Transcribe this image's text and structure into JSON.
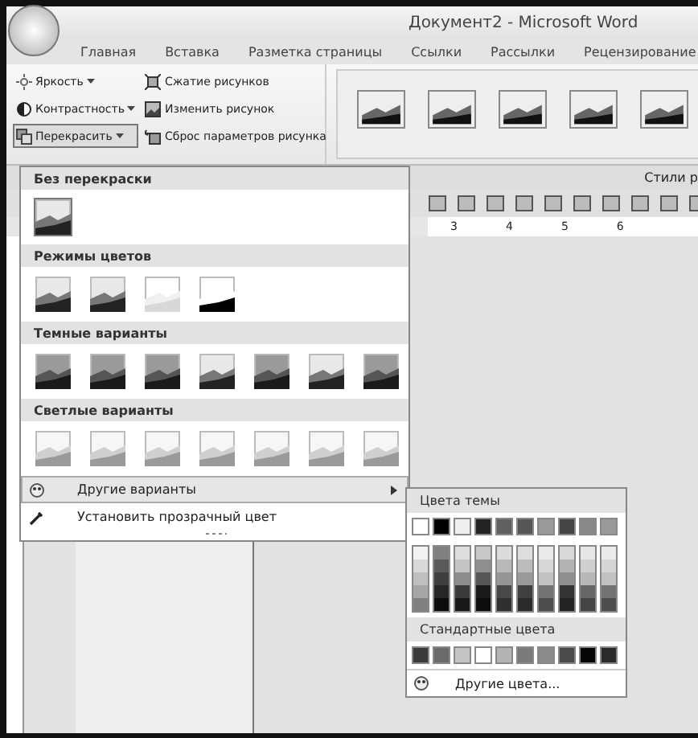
{
  "window": {
    "title": "Документ2 - Microsoft Word"
  },
  "tabs": [
    {
      "label": "Главная"
    },
    {
      "label": "Вставка"
    },
    {
      "label": "Разметка страницы"
    },
    {
      "label": "Ссылки"
    },
    {
      "label": "Рассылки"
    },
    {
      "label": "Рецензирование"
    }
  ],
  "ribbon": {
    "adjust_buttons": [
      {
        "label": "Яркость",
        "kind": "sun",
        "pressed": false
      },
      {
        "label": "Контрастность",
        "kind": "contrast",
        "pressed": false
      },
      {
        "label": "Перекрасить",
        "kind": "recolor",
        "pressed": true
      }
    ],
    "picture_buttons": [
      {
        "label": "Сжатие рисунков",
        "kind": "compress"
      },
      {
        "label": "Изменить рисунок",
        "kind": "change"
      },
      {
        "label": "Сброс параметров рисунка",
        "kind": "reset"
      }
    ],
    "group_label": "Стили р"
  },
  "ruler": {
    "marks": [
      "3",
      "4",
      "5",
      "6"
    ]
  },
  "recolor_menu": {
    "sections": [
      {
        "title": "Без перекраски",
        "thumbs": [
          {
            "kind": "normal",
            "selected": true
          }
        ]
      },
      {
        "title": "Режимы цветов",
        "thumbs": [
          {
            "kind": "normal",
            "selected": false
          },
          {
            "kind": "normal",
            "selected": false
          },
          {
            "kind": "washout",
            "selected": false
          },
          {
            "kind": "blackwhite",
            "selected": false
          }
        ]
      },
      {
        "title": "Темные варианты",
        "thumbs": [
          {
            "kind": "dark",
            "selected": false
          },
          {
            "kind": "dark",
            "selected": false
          },
          {
            "kind": "dark",
            "selected": false
          },
          {
            "kind": "normal",
            "selected": false
          },
          {
            "kind": "dark",
            "selected": false
          },
          {
            "kind": "normal",
            "selected": false
          },
          {
            "kind": "dark",
            "selected": false
          }
        ]
      },
      {
        "title": "Светлые варианты",
        "thumbs": [
          {
            "kind": "light",
            "selected": false
          },
          {
            "kind": "light",
            "selected": false
          },
          {
            "kind": "light",
            "selected": false
          },
          {
            "kind": "light",
            "selected": false
          },
          {
            "kind": "light",
            "selected": false
          },
          {
            "kind": "light",
            "selected": false
          },
          {
            "kind": "light",
            "selected": false
          }
        ]
      }
    ],
    "items": [
      {
        "label": "Другие варианты",
        "kind": "submenu",
        "highlighted": true
      },
      {
        "label": "Установить прозрачный цвет",
        "kind": "eyedropper",
        "highlighted": false
      }
    ]
  },
  "color_menu": {
    "theme_title": "Цвета темы",
    "theme_colors": [
      {
        "color": "#ffffff",
        "shades": [
          {
            "color": "#f2f2f2"
          },
          {
            "color": "#d9d9d9"
          },
          {
            "color": "#bfbfbf"
          },
          {
            "color": "#a6a6a6"
          },
          {
            "color": "#808080"
          }
        ]
      },
      {
        "color": "#000000",
        "shades": [
          {
            "color": "#7f7f7f"
          },
          {
            "color": "#595959"
          },
          {
            "color": "#3f3f3f"
          },
          {
            "color": "#262626"
          },
          {
            "color": "#0d0d0d"
          }
        ]
      },
      {
        "color": "#eeeeee",
        "shades": [
          {
            "color": "#dddddd"
          },
          {
            "color": "#c4c4c4"
          },
          {
            "color": "#8c8c8c"
          },
          {
            "color": "#3a3a3a"
          },
          {
            "color": "#181818"
          }
        ]
      },
      {
        "color": "#222222",
        "shades": [
          {
            "color": "#c8c8c8"
          },
          {
            "color": "#8e8e8e"
          },
          {
            "color": "#555555"
          },
          {
            "color": "#1a1a1a"
          },
          {
            "color": "#0e0e0e"
          }
        ]
      },
      {
        "color": "#606060",
        "shades": [
          {
            "color": "#dcdcdc"
          },
          {
            "color": "#b9b9b9"
          },
          {
            "color": "#969696"
          },
          {
            "color": "#484848"
          },
          {
            "color": "#303030"
          }
        ]
      },
      {
        "color": "#555555",
        "shades": [
          {
            "color": "#dddddd"
          },
          {
            "color": "#bbbbbb"
          },
          {
            "color": "#999999"
          },
          {
            "color": "#404040"
          },
          {
            "color": "#2a2a2a"
          }
        ]
      },
      {
        "color": "#9a9a9a",
        "shades": [
          {
            "color": "#ebebeb"
          },
          {
            "color": "#d7d7d7"
          },
          {
            "color": "#c2c2c2"
          },
          {
            "color": "#747474"
          },
          {
            "color": "#4d4d4d"
          }
        ]
      },
      {
        "color": "#444444",
        "shades": [
          {
            "color": "#d9d9d9"
          },
          {
            "color": "#b4b4b4"
          },
          {
            "color": "#8f8f8f"
          },
          {
            "color": "#333333"
          },
          {
            "color": "#222222"
          }
        ]
      },
      {
        "color": "#888888",
        "shades": [
          {
            "color": "#e7e7e7"
          },
          {
            "color": "#cfcfcf"
          },
          {
            "color": "#b8b8b8"
          },
          {
            "color": "#666666"
          },
          {
            "color": "#444444"
          }
        ]
      },
      {
        "color": "#999999",
        "shades": [
          {
            "color": "#ebebeb"
          },
          {
            "color": "#d6d6d6"
          },
          {
            "color": "#c2c2c2"
          },
          {
            "color": "#737373"
          },
          {
            "color": "#4c4c4c"
          }
        ]
      }
    ],
    "standard_title": "Стандартные цвета",
    "standard_colors": [
      {
        "color": "#3a3a3a"
      },
      {
        "color": "#6a6a6a"
      },
      {
        "color": "#c4c4c4"
      },
      {
        "color": "#ffffff"
      },
      {
        "color": "#b4b4b4"
      },
      {
        "color": "#7a7a7a"
      },
      {
        "color": "#8a8a8a"
      },
      {
        "color": "#4a4a4a"
      },
      {
        "color": "#050505"
      },
      {
        "color": "#2a2a2a"
      }
    ],
    "more_colors": "Другие цвета..."
  }
}
